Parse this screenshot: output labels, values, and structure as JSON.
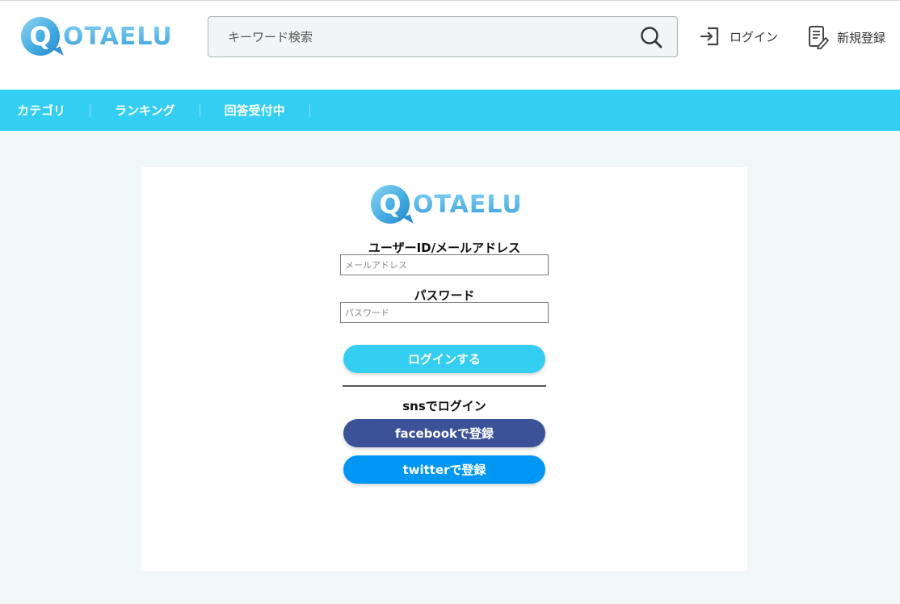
{
  "brand": {
    "q_letter": "Q",
    "wordmark": "OTAELU"
  },
  "header": {
    "search_placeholder": "キーワード検索",
    "login_label": "ログイン",
    "signup_label": "新規登録"
  },
  "nav": {
    "items": [
      {
        "label": "カテゴリ"
      },
      {
        "label": "ランキング"
      },
      {
        "label": "回答受付中"
      }
    ]
  },
  "login_form": {
    "user_label": "ユーザーID/メールアドレス",
    "user_placeholder": "メールアドレス",
    "password_label": "パスワード",
    "password_placeholder": "パスワード",
    "login_button": "ログインする",
    "sns_heading": "snsでログイン",
    "facebook_button": "facebookで登録",
    "twitter_button": "twitterで登録"
  },
  "colors": {
    "accent": "#33cef2",
    "facebook": "#3b5299",
    "twitter": "#0096f4",
    "page_bg": "#f0f7f7"
  },
  "icons": {
    "search": "search-icon",
    "login": "login-icon",
    "signup": "signup-icon"
  }
}
